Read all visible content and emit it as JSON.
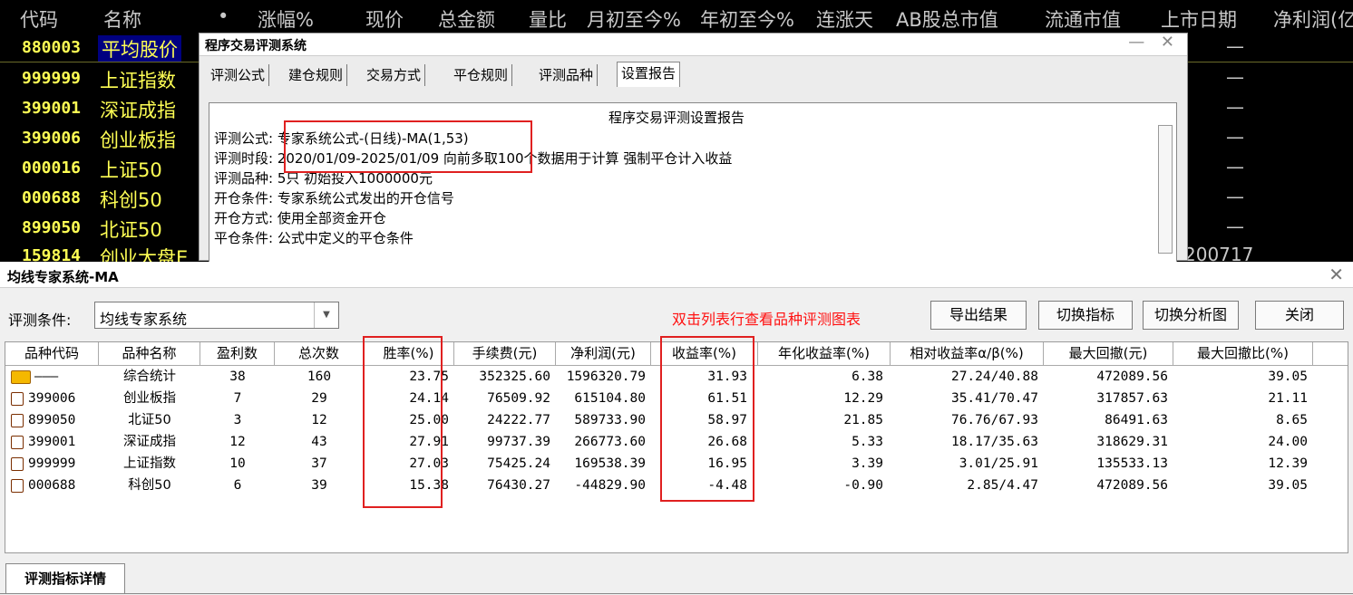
{
  "board": {
    "headers": [
      "代码",
      "名称",
      "•",
      "涨幅%",
      "现价",
      "总金额",
      "量比",
      "月初至今%",
      "年初至今%",
      "连涨天",
      "AB股总市值",
      "流通市值",
      "上市日期",
      "净利润(亿)"
    ],
    "rows": [
      {
        "code": "880003",
        "name": "平均股价",
        "dash": "—"
      },
      {
        "code": "999999",
        "name": "上证指数",
        "dash": "—"
      },
      {
        "code": "399001",
        "name": "深证成指",
        "dash": "—"
      },
      {
        "code": "399006",
        "name": "创业板指",
        "dash": "—"
      },
      {
        "code": "000016",
        "name": "上证50",
        "dash": "—"
      },
      {
        "code": "000688",
        "name": "科创50",
        "dash": "—"
      },
      {
        "code": "899050",
        "name": "北证50",
        "dash": "—"
      },
      {
        "code": "159814",
        "name": "创业大盘E",
        "dash": "200717"
      }
    ]
  },
  "back_dialog": {
    "title": "程序交易评测系统",
    "controls": "— ✕",
    "tabs": [
      "评测公式",
      "建仓规则",
      "交易方式",
      "平仓规则",
      "评测品种",
      "设置报告"
    ],
    "report_title": "程序交易评测设置报告",
    "lines": [
      "评测公式: 专家系统公式-(日线)-MA(1,53)",
      "评测时段: 2020/01/09-2025/01/09 向前多取100个数据用于计算 强制平仓计入收益",
      "评测品种: 5只 初始投入1000000元",
      "开仓条件: 专家系统公式发出的开仓信号",
      "开仓方式: 使用全部资金开仓",
      "平仓条件: 公式中定义的平仓条件"
    ]
  },
  "window": {
    "title": "均线专家系统-MA",
    "close": "✕",
    "condition_label": "评测条件:",
    "condition_value": "均线专家系统",
    "hint": "双击列表行查看品种评测图表",
    "buttons": {
      "export": "导出结果",
      "switch_indicator": "切换指标",
      "switch_chart": "切换分析图",
      "close": "关闭"
    },
    "bottom_tab": "评测指标详情"
  },
  "table": {
    "columns": [
      "品种代码",
      "品种名称",
      "盈利数",
      "总次数",
      "胜率(%)",
      "手续费(元)",
      "净利润(元)",
      "收益率(%)",
      "年化收益率(%)",
      "相对收益率α/β(%)",
      "最大回撤(元)",
      "最大回撤比(%)"
    ],
    "rows": [
      {
        "code": "———",
        "name": "综合统计",
        "win": "38",
        "total": "160",
        "rate": "23.75",
        "fee": "352325.60",
        "profit": "1596320.79",
        "ret": "31.93",
        "annual": "6.38",
        "rel": "27.24/40.88",
        "dd": "472089.56",
        "ddr": "39.05"
      },
      {
        "code": "399006",
        "name": "创业板指",
        "win": "7",
        "total": "29",
        "rate": "24.14",
        "fee": "76509.92",
        "profit": "615104.80",
        "ret": "61.51",
        "annual": "12.29",
        "rel": "35.41/70.47",
        "dd": "317857.63",
        "ddr": "21.11"
      },
      {
        "code": "899050",
        "name": "北证50",
        "win": "3",
        "total": "12",
        "rate": "25.00",
        "fee": "24222.77",
        "profit": "589733.90",
        "ret": "58.97",
        "annual": "21.85",
        "rel": "76.76/67.93",
        "dd": "86491.63",
        "ddr": "8.65"
      },
      {
        "code": "399001",
        "name": "深证成指",
        "win": "12",
        "total": "43",
        "rate": "27.91",
        "fee": "99737.39",
        "profit": "266773.60",
        "ret": "26.68",
        "annual": "5.33",
        "rel": "18.17/35.63",
        "dd": "318629.31",
        "ddr": "24.00"
      },
      {
        "code": "999999",
        "name": "上证指数",
        "win": "10",
        "total": "37",
        "rate": "27.03",
        "fee": "75425.24",
        "profit": "169538.39",
        "ret": "16.95",
        "annual": "3.39",
        "rel": "3.01/25.91",
        "dd": "135533.13",
        "ddr": "12.39"
      },
      {
        "code": "000688",
        "name": "科创50",
        "win": "6",
        "total": "39",
        "rate": "15.38",
        "fee": "76430.27",
        "profit": "-44829.90",
        "ret": "-4.48",
        "annual": "-0.90",
        "rel": "2.85/4.47",
        "dd": "472089.56",
        "ddr": "39.05"
      }
    ]
  },
  "colors": {
    "board_text": "#ffff54",
    "hint": "#ff1010",
    "highlight_box": "#e02020"
  }
}
